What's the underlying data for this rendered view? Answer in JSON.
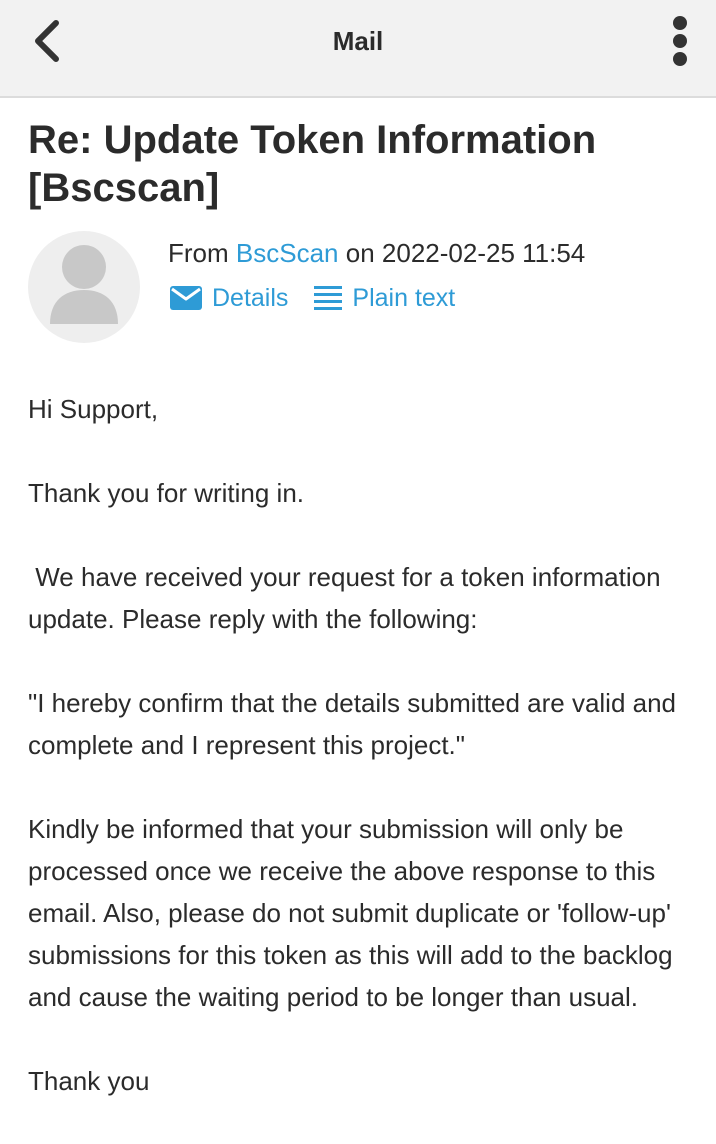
{
  "header": {
    "title": "Mail",
    "back_icon": "chevron-left-icon",
    "menu_icon": "more-vertical-icon"
  },
  "message": {
    "subject": "Re: Update Token Information [Bscscan]",
    "from_prefix": "From",
    "sender": "BscScan",
    "date_connector": "on",
    "date": "2022-02-25 11:54",
    "actions": {
      "details_label": "Details",
      "details_icon": "envelope-icon",
      "plain_text_label": "Plain text",
      "plain_text_icon": "lines-icon"
    },
    "body": {
      "greeting": "Hi Support,",
      "p1": "Thank you for writing in.",
      "p2": " We have received your request for a token information update. Please reply with the following:",
      "p3": "\"I hereby confirm that the details submitted are valid and complete and I represent this project.\"",
      "p4": "Kindly be informed that your submission will only be processed once we receive the above response to this email. Also, please do not submit duplicate or 'follow-up' submissions for this token as this will add to the backlog and cause the waiting period to be longer than usual.",
      "closing": "Thank you"
    }
  },
  "colors": {
    "link": "#2e9bd6",
    "header_bg": "#f2f2f2",
    "text": "#2b2b2b"
  }
}
